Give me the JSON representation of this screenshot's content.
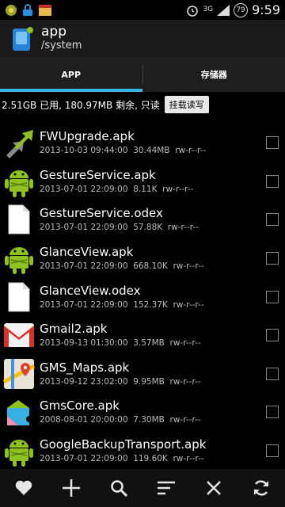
{
  "status_bar": {
    "network": "3G",
    "battery": "79",
    "time": "9:59"
  },
  "action_bar": {
    "title": "app",
    "subtitle": "/system"
  },
  "tabs": [
    {
      "label": "APP",
      "active": true
    },
    {
      "label": "存储器",
      "active": false
    }
  ],
  "storage": {
    "info": "2.51GB 已用, 180.97MB 剩余, 只读",
    "mount_button": "挂载读写"
  },
  "files": [
    {
      "name": "FWUpgrade.apk",
      "meta": "2013-10-03 09:44:00  30.44MB  rw-r--r--",
      "icon": "upgrade-arrow-icon"
    },
    {
      "name": "GestureService.apk",
      "meta": "2013-07-01 22:09:00  8.11K  rw-r--r--",
      "icon": "android-icon"
    },
    {
      "name": "GestureService.odex",
      "meta": "2013-07-01 22:09:00  57.88K  rw-r--r--",
      "icon": "file-icon"
    },
    {
      "name": "GlanceView.apk",
      "meta": "2013-07-01 22:09:00  668.10K  rw-r--r--",
      "icon": "android-icon"
    },
    {
      "name": "GlanceView.odex",
      "meta": "2013-07-01 22:09:00  152.37K  rw-r--r--",
      "icon": "file-icon"
    },
    {
      "name": "Gmail2.apk",
      "meta": "2013-09-13 01:30:00  3.57MB  rw-r--r--",
      "icon": "gmail-icon"
    },
    {
      "name": "GMS_Maps.apk",
      "meta": "2013-09-12 23:02:00  9.95MB  rw-r--r--",
      "icon": "maps-icon"
    },
    {
      "name": "GmsCore.apk",
      "meta": "2008-08-01 20:00:00  7.30MB  rw-r--r--",
      "icon": "puzzle-icon"
    },
    {
      "name": "GoogleBackupTransport.apk",
      "meta": "2013-07-01 22:09:00  119.60K  rw-r--r--",
      "icon": "android-icon"
    }
  ],
  "bottom_bar": [
    "heart-icon",
    "add-icon",
    "search-icon",
    "sort-icon",
    "close-icon",
    "refresh-icon"
  ],
  "colors": {
    "accent": "#33b5e5",
    "android_green": "#8ec21f"
  }
}
